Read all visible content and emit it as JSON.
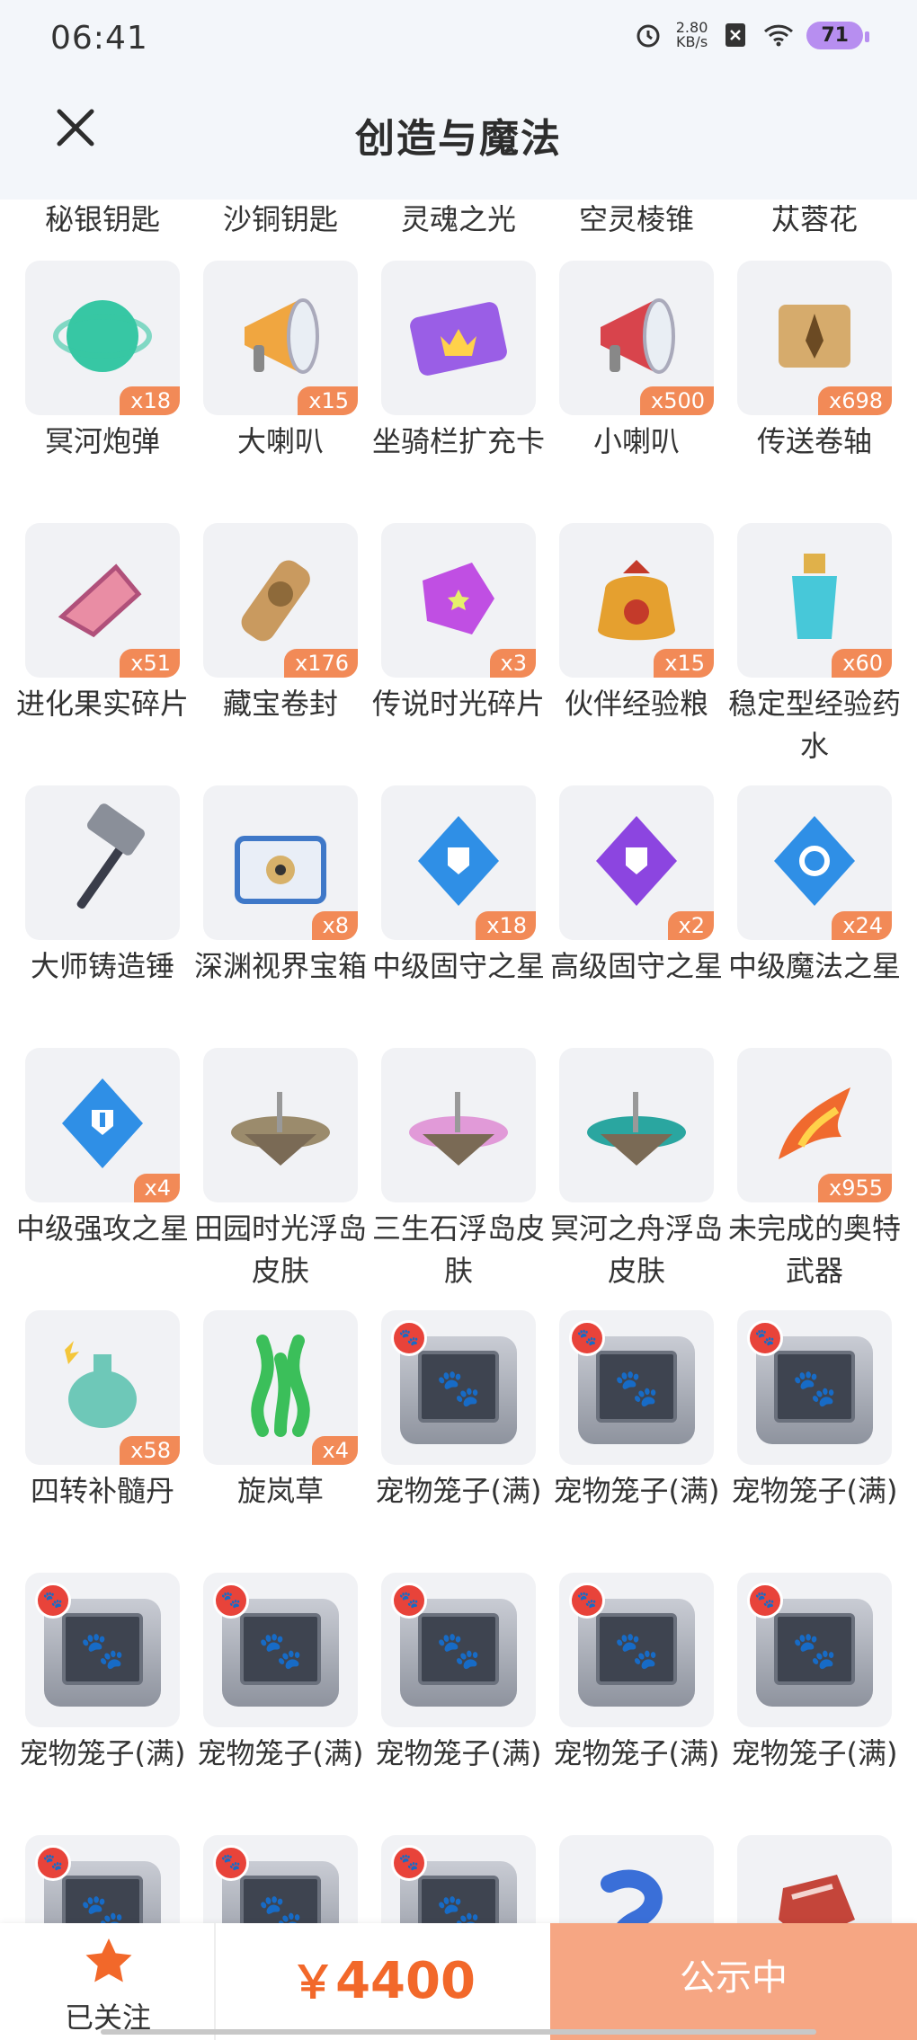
{
  "status": {
    "time": "06:41",
    "speed_value": "2.80",
    "speed_unit": "KB/s",
    "battery": "71"
  },
  "header": {
    "title": "创造与魔法"
  },
  "partial_row": [
    "秘银钥匙",
    "沙铜钥匙",
    "灵魂之光",
    "空灵棱锥",
    "苁蓉花"
  ],
  "items": [
    {
      "name": "冥河炮弹",
      "qty": "x18",
      "icon": "cannonball-icon",
      "color": "#37c7a4"
    },
    {
      "name": "大喇叭",
      "qty": "x15",
      "icon": "megaphone-icon",
      "color": "#f0a640"
    },
    {
      "name": "坐骑栏扩充卡",
      "qty": "",
      "icon": "card-icon",
      "color": "#9a5ee6"
    },
    {
      "name": "小喇叭",
      "qty": "x500",
      "icon": "megaphone-icon",
      "color": "#d8444c"
    },
    {
      "name": "传送卷轴",
      "qty": "x698",
      "icon": "scroll-icon",
      "color": "#d6ab6c"
    },
    {
      "name": "进化果实碎片",
      "qty": "x51",
      "icon": "fruit-shard-icon",
      "color": "#e98da4"
    },
    {
      "name": "藏宝卷封",
      "qty": "x176",
      "icon": "treasure-scroll-icon",
      "color": "#c99a5f"
    },
    {
      "name": "传说时光碎片",
      "qty": "x3",
      "icon": "time-shard-icon",
      "color": "#c04fe3"
    },
    {
      "name": "伙伴经验粮",
      "qty": "x15",
      "icon": "food-bag-icon",
      "color": "#e5a02f"
    },
    {
      "name": "稳定型经验药水",
      "qty": "x60",
      "icon": "potion-icon",
      "color": "#47c8d9"
    },
    {
      "name": "大师铸造锤",
      "qty": "",
      "icon": "hammer-icon",
      "color": "#8a8f99"
    },
    {
      "name": "深渊视界宝箱",
      "qty": "x8",
      "icon": "chest-icon",
      "color": "#3f78c8"
    },
    {
      "name": "中级固守之星",
      "qty": "x18",
      "icon": "shield-star-icon",
      "color": "#2f8fe6"
    },
    {
      "name": "高级固守之星",
      "qty": "x2",
      "icon": "shield-star-icon",
      "color": "#8c45e0"
    },
    {
      "name": "中级魔法之星",
      "qty": "x24",
      "icon": "magic-star-icon",
      "color": "#2f8fe6"
    },
    {
      "name": "中级强攻之星",
      "qty": "x4",
      "icon": "attack-star-icon",
      "color": "#2f8fe6"
    },
    {
      "name": "田园时光浮岛皮肤",
      "qty": "",
      "icon": "island-icon",
      "color": "#9b8b6c"
    },
    {
      "name": "三生石浮岛皮肤",
      "qty": "",
      "icon": "island-icon",
      "color": "#e19ad8"
    },
    {
      "name": "冥河之舟浮岛皮肤",
      "qty": "",
      "icon": "island-icon",
      "color": "#2aa6a0"
    },
    {
      "name": "未完成的奥特武器",
      "qty": "x955",
      "icon": "flame-weapon-icon",
      "color": "#f06a2e"
    },
    {
      "name": "四转补髓丹",
      "qty": "x58",
      "icon": "elixir-icon",
      "color": "#6ec8b8"
    },
    {
      "name": "旋岚草",
      "qty": "x4",
      "icon": "herb-icon",
      "color": "#3bbf5a"
    },
    {
      "name": "宠物笼子(满)",
      "qty": "",
      "icon": "pet-cage-icon",
      "color": "#8e939e"
    },
    {
      "name": "宠物笼子(满)",
      "qty": "",
      "icon": "pet-cage-icon",
      "color": "#8e939e"
    },
    {
      "name": "宠物笼子(满)",
      "qty": "",
      "icon": "pet-cage-icon",
      "color": "#8e939e"
    },
    {
      "name": "宠物笼子(满)",
      "qty": "",
      "icon": "pet-cage-icon",
      "color": "#8e939e"
    },
    {
      "name": "宠物笼子(满)",
      "qty": "",
      "icon": "pet-cage-icon",
      "color": "#8e939e"
    },
    {
      "name": "宠物笼子(满)",
      "qty": "",
      "icon": "pet-cage-icon",
      "color": "#8e939e"
    },
    {
      "name": "宠物笼子(满)",
      "qty": "",
      "icon": "pet-cage-icon",
      "color": "#8e939e"
    },
    {
      "name": "宠物笼子(满)",
      "qty": "",
      "icon": "pet-cage-icon",
      "color": "#8e939e"
    },
    {
      "name": "",
      "qty": "",
      "icon": "pet-cage-icon",
      "color": "#8e939e"
    },
    {
      "name": "",
      "qty": "",
      "icon": "pet-cage-icon",
      "color": "#8e939e"
    },
    {
      "name": "",
      "qty": "",
      "icon": "pet-cage-icon",
      "color": "#8e939e"
    },
    {
      "name": "",
      "qty": "",
      "icon": "tentacle-icon",
      "color": "#3a6fd8"
    },
    {
      "name": "",
      "qty": "",
      "icon": "meat-icon",
      "color": "#c4453a"
    }
  ],
  "bottom_bar": {
    "follow_label": "已关注",
    "price_symbol": "￥",
    "price": "4400",
    "publish_label": "公示中"
  },
  "colors": {
    "accent": "#f2682a",
    "badge": "#f28a57",
    "publish_bg": "#f6a683"
  }
}
